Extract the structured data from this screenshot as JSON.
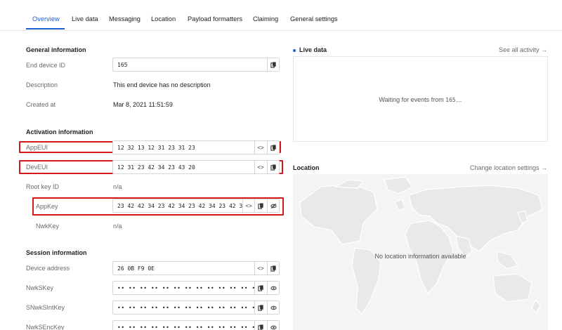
{
  "tabs": [
    "Overview",
    "Live data",
    "Messaging",
    "Location",
    "Payload formatters",
    "Claiming",
    "General settings"
  ],
  "top_right_partial": "· ",
  "general": {
    "title": "General information",
    "end_device_id_label": "End device ID",
    "end_device_id": "165",
    "description_label": "Description",
    "description": "This end device has no description",
    "created_label": "Created at",
    "created": "Mar 8, 2021 11:51:59"
  },
  "activation": {
    "title": "Activation information",
    "appeui_label": "AppEUI",
    "appeui": "12 32 13 12 31 23 31 23",
    "deveui_label": "DevEUI",
    "deveui": "12 31 23 42 34 23 43 20",
    "root_key_label": "Root key ID",
    "root_key": "n/a",
    "appkey_label": "AppKey",
    "appkey": "23 42 42 34 23 42 34 23 42 34 23 42 34 2…",
    "nwkkey_label": "NwkKey",
    "nwkkey": "n/a"
  },
  "session": {
    "title": "Session information",
    "devaddr_label": "Device address",
    "devaddr": "26 0B F9 0E",
    "nwkskey_label": "NwkSKey",
    "snwksintkey_label": "SNwkSIntKey",
    "nwksenckey_label": "NwkSEncKey",
    "masked": "•• •• •• •• •• •• •• •• •• •• •• •• •• •• •• ••"
  },
  "live_data": {
    "title": "Live data",
    "link": "See all activity →",
    "waiting": "Waiting for events from ",
    "waiting_id": "165",
    "ellipsis": "…"
  },
  "location": {
    "title": "Location",
    "link": "Change location settings →",
    "empty": "No location information available"
  },
  "colors": {
    "accent": "#1d5fd6",
    "highlight": "#d0191c"
  }
}
